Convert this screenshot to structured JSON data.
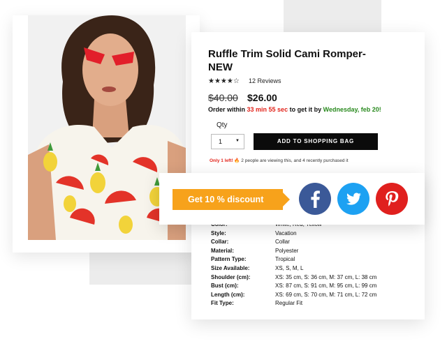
{
  "product": {
    "title": "Ruffle Trim Solid Cami Romper-NEW",
    "rating_stars": "★★★★☆",
    "reviews": "12 Reviews",
    "old_price": "$40.00",
    "new_price": "$26.00",
    "order": {
      "prefix": "Order within",
      "countdown": "33 min 55 sec",
      "middle": "to get it by",
      "date": "Wednesday, feb 20!"
    },
    "qty_label": "Qty",
    "qty_value": "1",
    "add_button": "ADD TO SHOPPING BAG",
    "urgency": {
      "strong": "Only 1 left!",
      "rest": "🔥 2 people are viewing this, and 4 recently purchased it"
    }
  },
  "share": {
    "discount": "Get 10 % discount",
    "facebook_icon": "facebook-icon",
    "twitter_icon": "twitter-icon",
    "pinterest_icon": "pinterest-icon"
  },
  "specs": [
    {
      "label": "Color:",
      "value": "White, Red, Yellow"
    },
    {
      "label": "Style:",
      "value": "Vacation"
    },
    {
      "label": "Collar:",
      "value": "Collar"
    },
    {
      "label": "Material:",
      "value": "Polyester"
    },
    {
      "label": "Pattern Type:",
      "value": "Tropical"
    },
    {
      "label": "Size Available:",
      "value": "XS, S, M, L"
    },
    {
      "label": "Shoulder (cm):",
      "value": "XS: 35 cm, S: 36 cm, M: 37 cm, L: 38 cm"
    },
    {
      "label": "Bust (cm):",
      "value": "XS: 87 cm, S: 91 cm, M: 95 cm, L: 99 cm"
    },
    {
      "label": "Length (cm):",
      "value": "XS: 69 cm, S: 70 cm, M: 71 cm, L: 72 cm"
    },
    {
      "label": "Fit Type:",
      "value": "Regular Fit"
    }
  ],
  "colors": {
    "discount": "#f7a21b",
    "facebook": "#3b5998",
    "twitter": "#1da1f2",
    "pinterest": "#e0201e",
    "countdown": "#e2231a",
    "date": "#2a8a1f"
  }
}
